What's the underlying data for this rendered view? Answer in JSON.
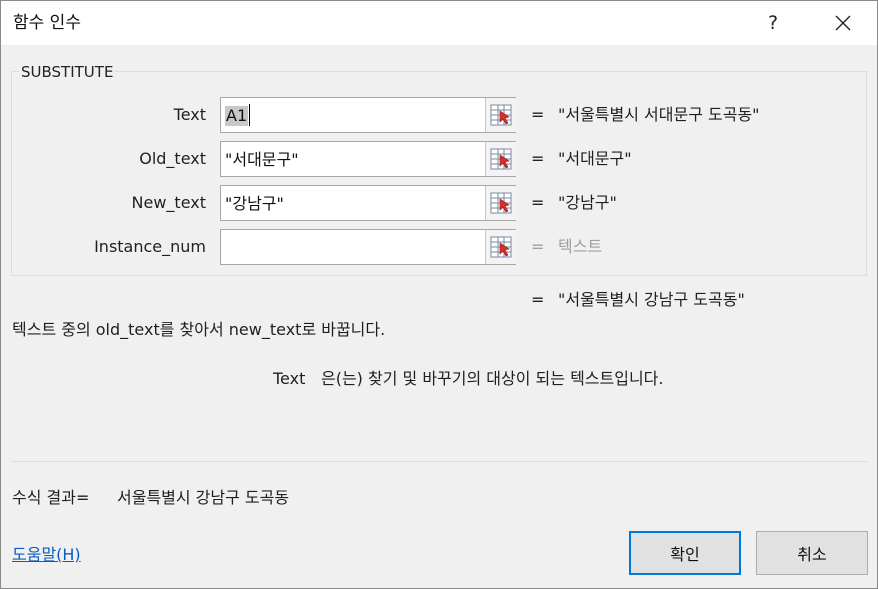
{
  "window": {
    "title": "함수 인수",
    "help_glyph": "?"
  },
  "function": {
    "name": "SUBSTITUTE",
    "description": "텍스트 중의 old_text를 찾아서 new_text로 바꿉니다.",
    "result_equals": "=",
    "result": "\"서울특별시 강남구 도곡동\""
  },
  "arguments": [
    {
      "label": "Text",
      "value": "A1",
      "selected": true,
      "equals": "=",
      "result": "\"서울특별시 서대문구 도곡동\""
    },
    {
      "label": "Old_text",
      "value": "\"서대문구\"",
      "equals": "=",
      "result": "\"서대문구\""
    },
    {
      "label": "New_text",
      "value": "\"강남구\"",
      "equals": "=",
      "result": "\"강남구\""
    },
    {
      "label": "Instance_num",
      "value": "",
      "equals": "=",
      "result": "텍스트"
    }
  ],
  "argument_help": {
    "name": "Text",
    "text": "은(는) 찾기 및 바꾸기의 대상이 되는 텍스트입니다."
  },
  "formula_result": {
    "label": "수식 결과=",
    "value": "서울특별시 강남구 도곡동"
  },
  "help_link": "도움말(H)",
  "buttons": {
    "ok": "확인",
    "cancel": "취소"
  },
  "icons": {
    "help": "question-mark-icon",
    "close": "close-icon",
    "range_picker": "range-select-icon"
  },
  "colors": {
    "accent": "#0078d7",
    "link": "#0a5cc2",
    "dialog_bg": "#f0f0f0",
    "muted_text": "#a0a0a0",
    "ref_icon_red": "#d9302c"
  }
}
